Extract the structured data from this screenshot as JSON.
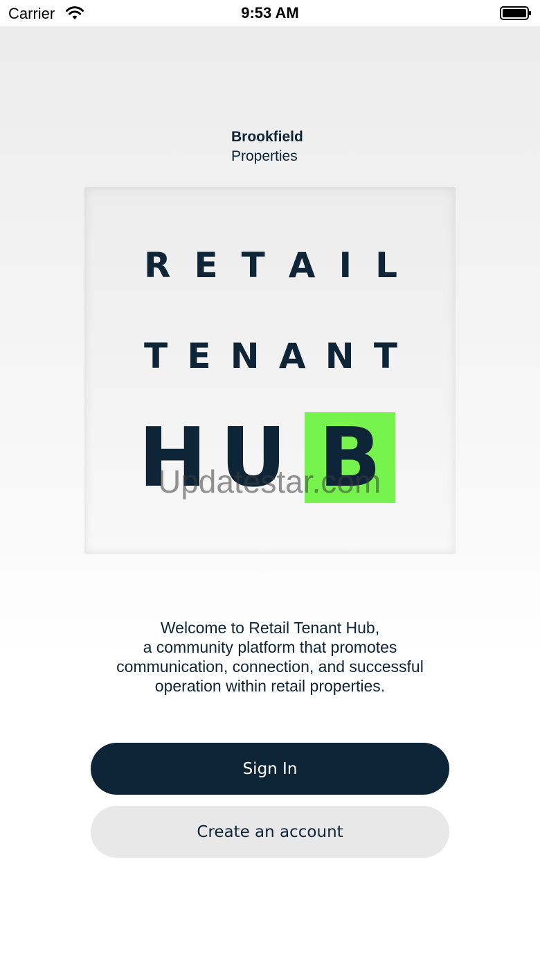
{
  "status_bar": {
    "carrier": "Carrier",
    "time": "9:53 AM",
    "icons": [
      "wifi-icon",
      "battery-icon"
    ]
  },
  "brand": {
    "name": "Brookfield",
    "subtitle": "Properties"
  },
  "logo": {
    "retail_letters": [
      "R",
      "E",
      "T",
      "A",
      "I",
      "L"
    ],
    "tenant_letters": [
      "T",
      "E",
      "N",
      "A",
      "N",
      "T"
    ],
    "hub_letters": [
      "H",
      "U",
      "B"
    ],
    "accent_color": "#76f34c",
    "text_color": "#0e2538"
  },
  "watermark": "Updatestar.com",
  "welcome": {
    "lines": [
      "Welcome to Retail Tenant Hub,",
      "a community platform that promotes",
      "communication, connection, and successful",
      "operation within retail properties."
    ]
  },
  "buttons": {
    "sign_in": "Sign In",
    "create_account": "Create an account",
    "primary_color": "#0e2538",
    "secondary_color": "#e8e8e8"
  }
}
